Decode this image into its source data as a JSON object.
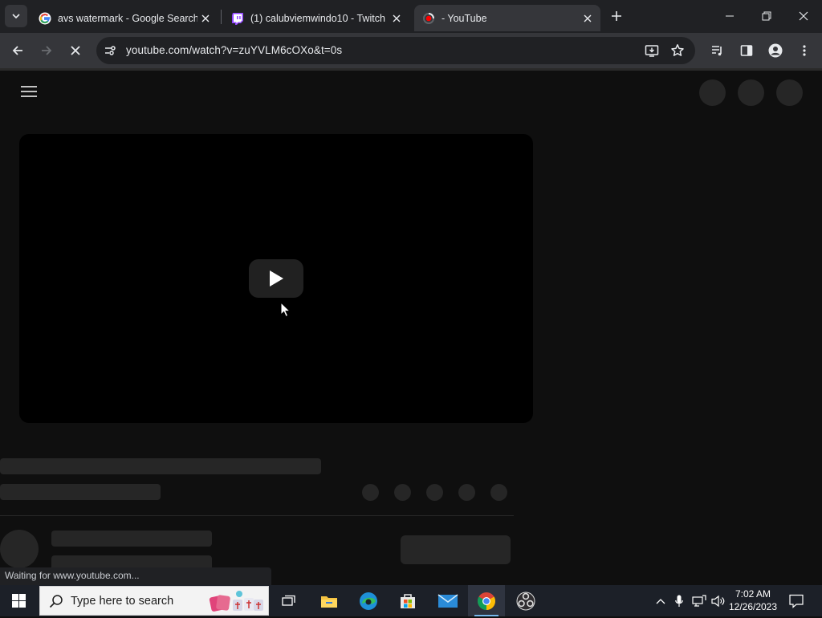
{
  "browser": {
    "tabs": [
      {
        "title": "avs watermark - Google Search",
        "favicon": "google-icon",
        "active": false
      },
      {
        "title": "(1) calubviemwindo10 - Twitch",
        "favicon": "twitch-icon",
        "active": false
      },
      {
        "title": "- YouTube",
        "favicon": "youtube-loading-icon",
        "active": true
      }
    ],
    "url": "youtube.com/watch?v=zuYVLM6cOXo&t=0s",
    "status_text": "Waiting for www.youtube.com..."
  },
  "taskbar": {
    "search_placeholder": "Type here to search",
    "time": "7:02 AM",
    "date": "12/26/2023",
    "pinned_apps": [
      "task-view",
      "file-explorer",
      "edge",
      "microsoft-store",
      "mail",
      "chrome",
      "obs-studio"
    ]
  },
  "colors": {
    "page_bg": "#0f0f0f",
    "skeleton": "#262626",
    "tab_active": "#35363a",
    "tabstrip": "#202124",
    "taskbar": "#1c2028"
  }
}
